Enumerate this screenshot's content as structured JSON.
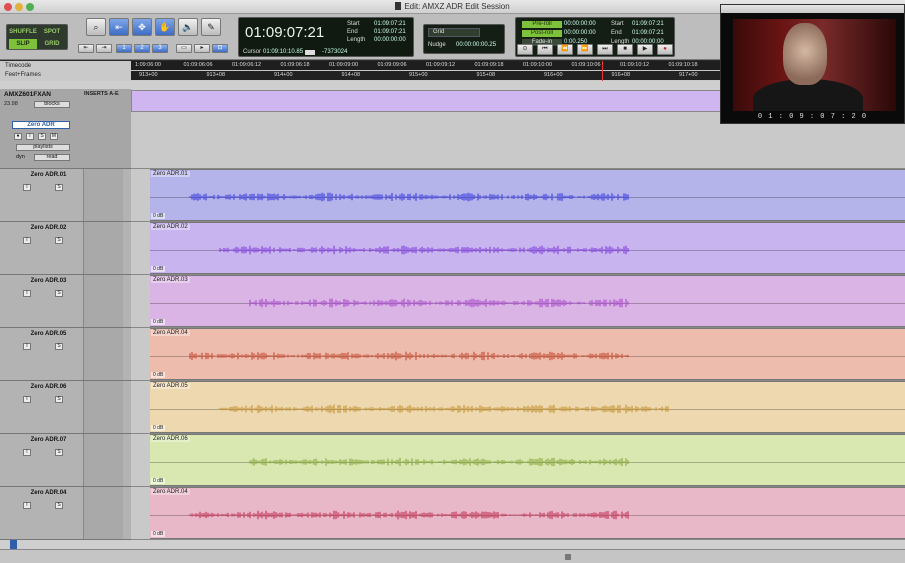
{
  "window": {
    "title": "Edit: AMXZ ADR Edit Session"
  },
  "toolbar": {
    "modes": [
      "SHUFFLE",
      "SPOT",
      "SLIP",
      "GRID"
    ],
    "active_modes": [
      "SLIP"
    ],
    "main_counter": "01:09:07:21",
    "selection": {
      "start_label": "Start",
      "start": "01:09:07:21",
      "end_label": "End",
      "end": "01:09:07:21",
      "length_label": "Length",
      "length": "00:00:00:00"
    },
    "cursor_label": "Cursor",
    "cursor_value": "01:09:10:10.85",
    "cursor_offset": "-7373024",
    "grid_label": "Grid",
    "nudge_label": "Nudge",
    "nudge_value": "00:00:00:00.25",
    "preroll_label": "Pre-roll",
    "preroll": "00:00:00:00",
    "postroll_label": "Post-roll",
    "postroll": "00:00:00:00",
    "fadein_label": "Fade-in",
    "fadein": "0:00.250",
    "tp_start_label": "Start",
    "tp_start": "01:09:07:21",
    "tp_end_label": "End",
    "tp_end": "01:09:07:21",
    "tp_length_label": "Length",
    "tp_length": "00:00:00:00"
  },
  "video": {
    "timecode": "0 1 : 0 9 : 0 7 : 2 0"
  },
  "rulers": {
    "timecode_label": "Timecode",
    "feetframes_label": "Feet+Frames",
    "timecode_ticks": [
      "1:09:06:00",
      "01:09:06:06",
      "01:09:06:12",
      "01:09:06:18",
      "01:09:09:00",
      "01:09:09:06",
      "01:09:09:12",
      "01:09:09:18",
      "01:09:10:00",
      "01:09:10:06",
      "01:09:10:12",
      "01:09:10:18"
    ],
    "feet_ticks": [
      "913+00",
      "913+08",
      "914+00",
      "914+08",
      "915+00",
      "915+08",
      "916+00",
      "916+08",
      "917+00"
    ]
  },
  "master_track": {
    "name": "AMXZ601FXAN",
    "rate": "23.98",
    "view": "blocks",
    "inserts_label": "INSERTS A-E",
    "track_name": "Zero ADR",
    "playlists": "playlists",
    "automation": "read",
    "dyn": "dyn"
  },
  "tracks": [
    {
      "head": "Zero ADR.01",
      "clip": "Zero ADR.01",
      "color": "#b5b4ea",
      "wave": "#2b2be0",
      "db": "0 dB"
    },
    {
      "head": "Zero ADR.02",
      "clip": "Zero ADR.02",
      "color": "#c8b4ee",
      "wave": "#7a2ee0",
      "db": "0 dB"
    },
    {
      "head": "Zero ADR.03",
      "clip": "Zero ADR.03",
      "color": "#dab4e4",
      "wave": "#a43ccc",
      "db": "0 dB"
    },
    {
      "head": "Zero ADR.05",
      "clip": "Zero ADR.04",
      "color": "#eebcac",
      "wave": "#c03a20",
      "db": "0 dB"
    },
    {
      "head": "Zero ADR.06",
      "clip": "Zero ADR.05",
      "color": "#eed8b0",
      "wave": "#c08a20",
      "db": "0 dB"
    },
    {
      "head": "Zero ADR.07",
      "clip": "Zero ADR.06",
      "color": "#d8e8b0",
      "wave": "#80a030",
      "db": "0 dB"
    },
    {
      "head": "Zero ADR.04",
      "clip": "Zero ADR.04",
      "color": "#e8b8c8",
      "wave": "#c02048",
      "db": "0 dB"
    }
  ]
}
